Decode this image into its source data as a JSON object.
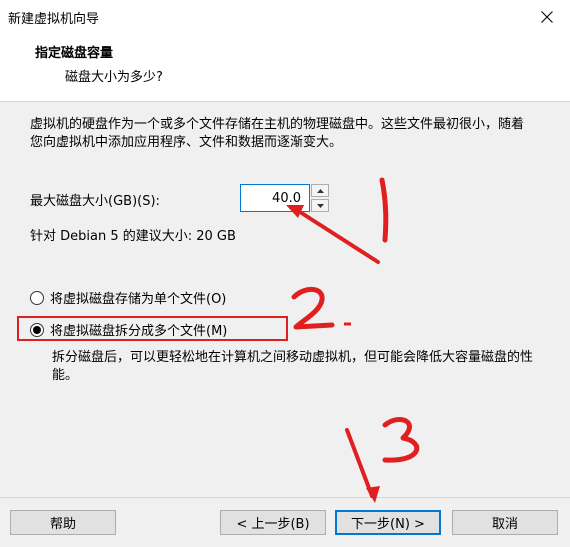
{
  "window": {
    "title": "新建虚拟机向导"
  },
  "header": {
    "heading": "指定磁盘容量",
    "subheading": "磁盘大小为多少?"
  },
  "content": {
    "description": "虚拟机的硬盘作为一个或多个文件存储在主机的物理磁盘中。这些文件最初很小，随着您向虚拟机中添加应用程序、文件和数据而逐渐变大。",
    "max_size_label": "最大磁盘大小(GB)(S):",
    "max_size_value": "40.0",
    "recommended": "针对 Debian 5 的建议大小: 20 GB",
    "radio_single_label": "将虚拟磁盘存储为单个文件(O)",
    "radio_multi_label": "将虚拟磁盘拆分成多个文件(M)",
    "selected_option": "multi",
    "split_note": "拆分磁盘后，可以更轻松地在计算机之间移动虚拟机，但可能会降低大容量磁盘的性能。"
  },
  "footer": {
    "help": "帮助",
    "back": "< 上一步(B)",
    "next": "下一步(N) >",
    "cancel": "取消"
  },
  "annotations": {
    "accent_color": "#e02020"
  }
}
